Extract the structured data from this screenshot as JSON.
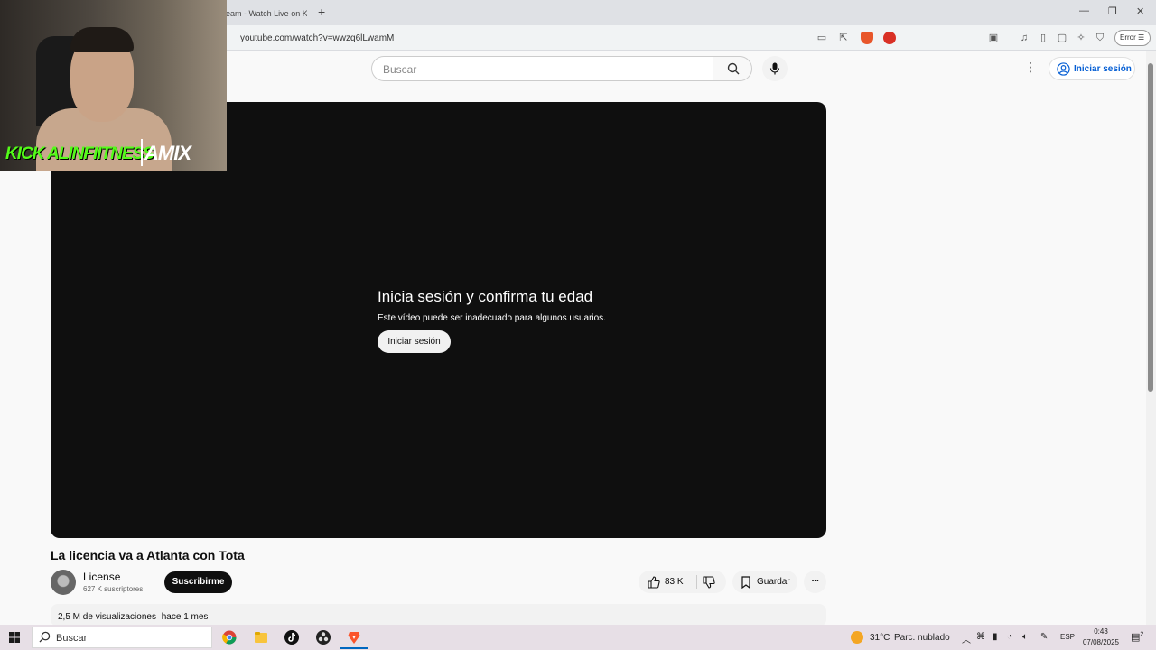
{
  "browser": {
    "tab_title": "eam - Watch Live on K",
    "new_tab_symbol": "+",
    "url": "youtube.com/watch?v=wwzq6lLwamM",
    "error_label": "Error"
  },
  "header": {
    "search_placeholder": "Buscar",
    "signin_label": "Iniciar sesión"
  },
  "player": {
    "age_title": "Inicia sesión y confirma tu edad",
    "age_description": "Este vídeo puede ser inadecuado para algunos usuarios.",
    "age_signin_button": "Iniciar sesión"
  },
  "video": {
    "title": "La licencia va a Atlanta con Tota",
    "channel_name": "License",
    "channel_subscribers": "627 K suscriptores",
    "subscribe_label": "Suscribirme",
    "likes": "83 K",
    "save_label": "Guardar",
    "views": "2,5 M de visualizaciones",
    "published": "hace 1 mes"
  },
  "overlay": {
    "kick_label": "KICK ALINFIITNESS",
    "brand_logo": "AMIX"
  },
  "taskbar": {
    "search_label": "Buscar",
    "weather_temp": "31°C",
    "weather_desc": "Parc. nublado",
    "language": "ESP",
    "time": "0:43",
    "date": "07/08/2025",
    "notification_count": "2"
  },
  "colors": {
    "youtube_blue": "#065fd4",
    "kick_green": "#53fc18",
    "player_bg": "#0f0f0f"
  }
}
